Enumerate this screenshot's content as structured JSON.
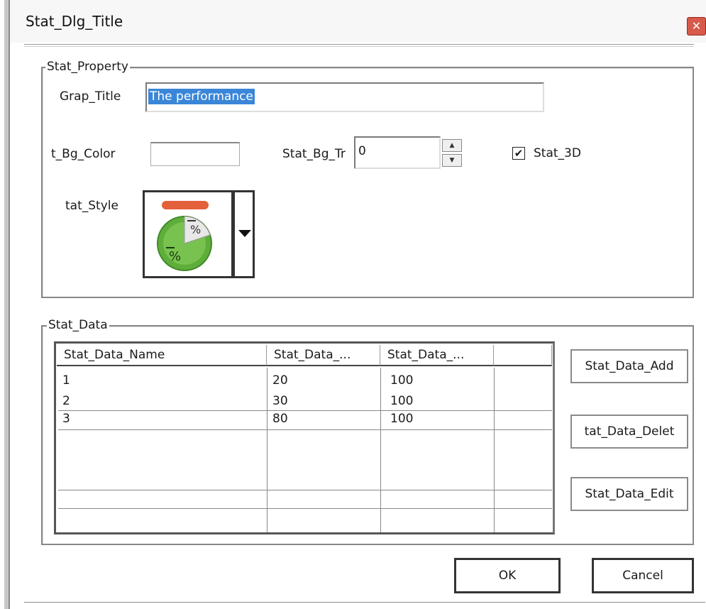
{
  "dialog": {
    "title": "Stat_Dlg_Title",
    "close_glyph": "✕"
  },
  "property_group": {
    "label": "Stat_Property",
    "graph_title_label": "Grap_Title",
    "graph_title_value": "The performance",
    "bg_color_label": "t_Bg_Color",
    "bg_transparency_label": "Stat_Bg_Tr",
    "bg_transparency_value": "0",
    "three_d_label": "Stat_3D",
    "three_d_checked": true,
    "style_label": "tat_Style",
    "style_preview_icon": "pie-chart-percent-icon"
  },
  "data_group": {
    "label": "Stat_Data",
    "columns": [
      "Stat_Data_Name",
      "Stat_Data_...",
      "Stat_Data_..."
    ],
    "rows": [
      [
        "1",
        "20",
        "100"
      ],
      [
        "2",
        "30",
        "100"
      ],
      [
        "3",
        "80",
        "100"
      ]
    ],
    "add_button": "Stat_Data_Add",
    "delete_button": "tat_Data_Delet",
    "edit_button": "Stat_Data_Edit"
  },
  "footer": {
    "ok_button": "OK",
    "cancel_button": "Cancel"
  },
  "colors": {
    "selection": "#3a86d8",
    "pie_green": "#5fae3c",
    "pie_bar": "#e2603a"
  }
}
